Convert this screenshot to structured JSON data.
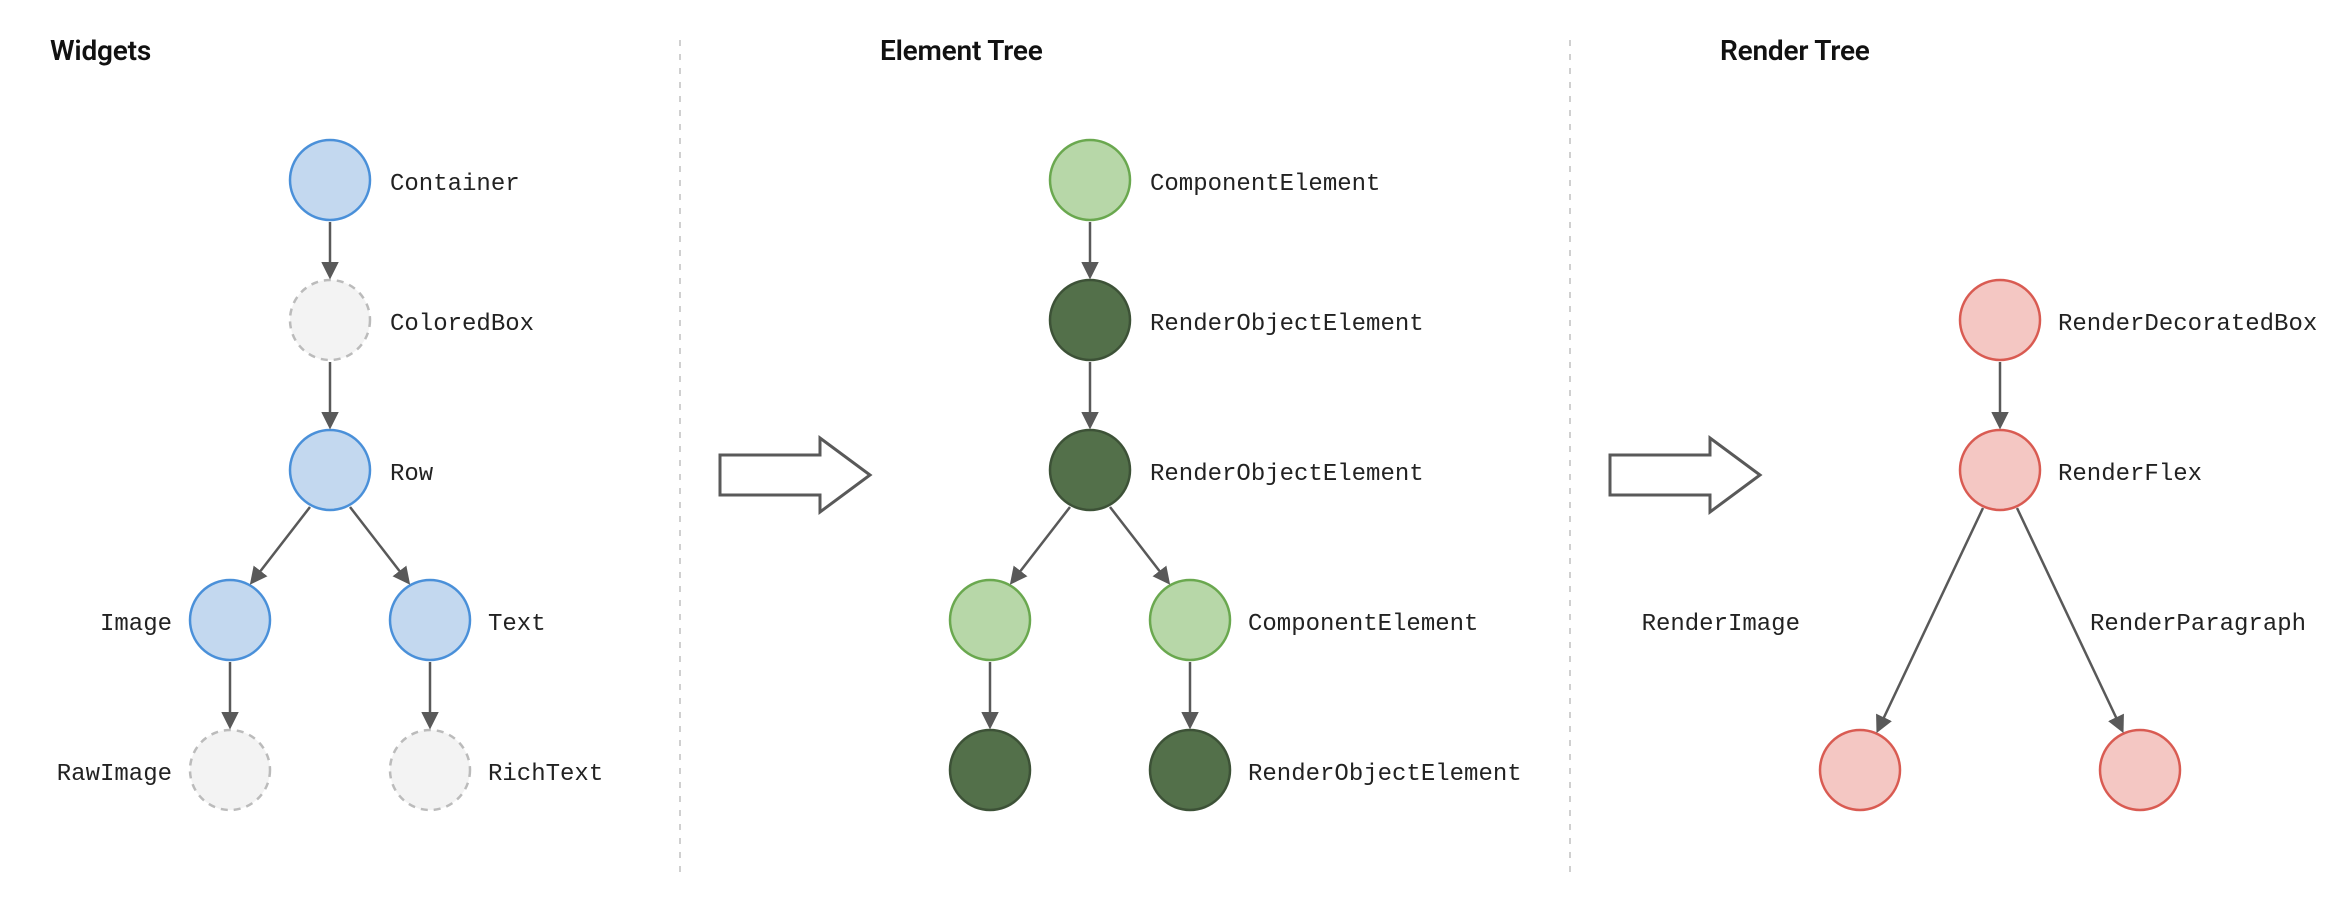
{
  "sections": {
    "widgets": {
      "title": "Widgets"
    },
    "elements": {
      "title": "Element Tree"
    },
    "render": {
      "title": "Render Tree"
    }
  },
  "widgets": {
    "container": "Container",
    "coloredbox": "ColoredBox",
    "row": "Row",
    "image": "Image",
    "text": "Text",
    "rawimage": "RawImage",
    "richtext": "RichText"
  },
  "elements": {
    "componentElement": "ComponentElement",
    "renderObjectElement": "RenderObjectElement"
  },
  "render": {
    "decoratedBox": "RenderDecoratedBox",
    "flex": "RenderFlex",
    "image": "RenderImage",
    "paragraph": "RenderParagraph"
  },
  "colors": {
    "nodeBlueFill": "#c3d8ef",
    "nodeBlueStroke": "#4a90d9",
    "nodeGreyFill": "#f3f3f3",
    "nodeGreyStroke": "#bbbbbb",
    "nodeLightGreenFill": "#b7d7a8",
    "nodeLightGreenStroke": "#6aa84f",
    "nodeDarkGreenFill": "#53704a",
    "nodeDarkGreenStroke": "#3d5237",
    "nodePinkFill": "#f4c7c3",
    "nodePinkStroke": "#d95b52",
    "arrowStroke": "#595959",
    "divider": "#d0d0d0"
  }
}
